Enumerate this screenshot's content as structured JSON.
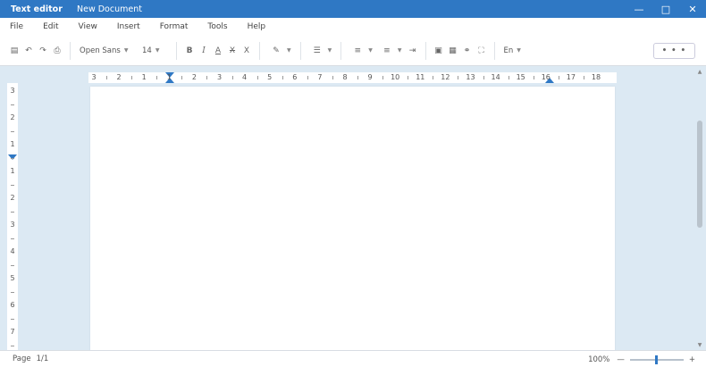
{
  "titlebar": {
    "app_name": "Text editor",
    "doc_name": "New Document"
  },
  "menu": [
    "File",
    "Edit",
    "View",
    "Insert",
    "Format",
    "Tools",
    "Help"
  ],
  "toolbar": {
    "font": "Open Sans",
    "size": "14",
    "bold": "B",
    "italic": "I",
    "underline": "A",
    "strike": "X",
    "clear": "X",
    "language": "En",
    "more": "• • •"
  },
  "hruler_labels": [
    "3",
    "2",
    "1",
    "1",
    "2",
    "3",
    "4",
    "5",
    "6",
    "7",
    "8",
    "9",
    "10",
    "11",
    "12",
    "13",
    "14",
    "15",
    "16",
    "17",
    "18"
  ],
  "vruler_labels": [
    "3",
    "2",
    "1",
    "1",
    "2",
    "3",
    "4",
    "5",
    "6",
    "7"
  ],
  "document": {
    "body_text": ""
  },
  "status": {
    "page_label": "Page",
    "page_value": "1/1",
    "zoom": "100%",
    "zoom_minus": "—",
    "zoom_plus": "+"
  }
}
